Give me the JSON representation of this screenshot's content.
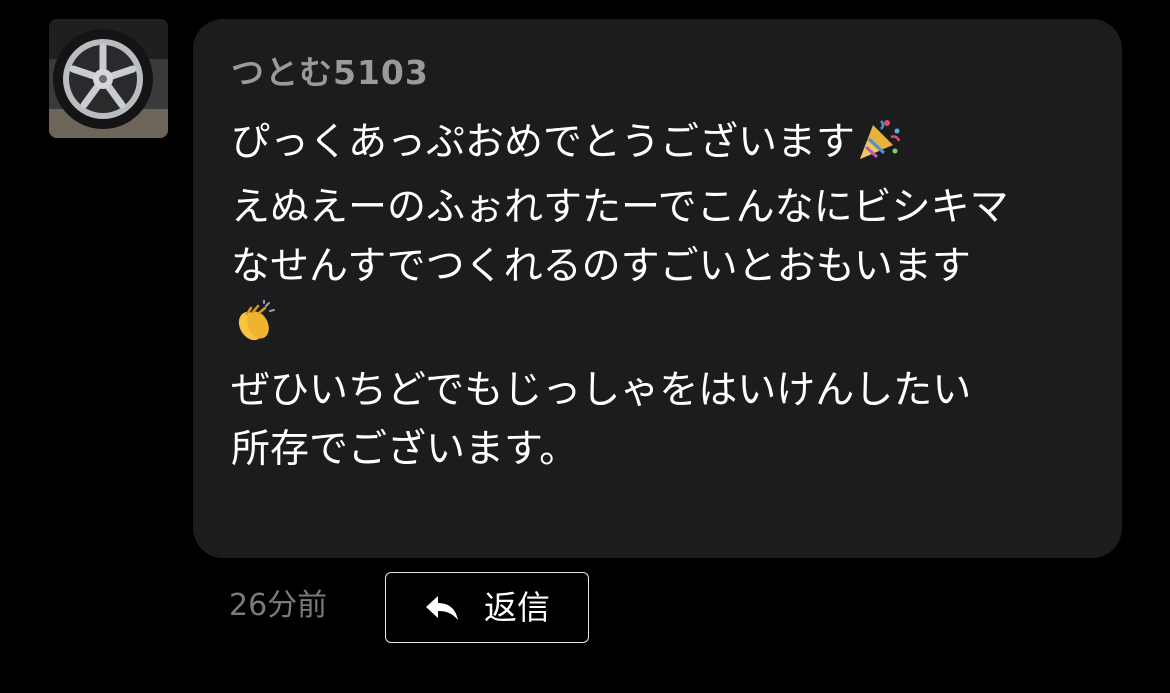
{
  "comment": {
    "username": "つとむ5103",
    "message_lines": [
      "ぴっくあっぷおめでとうございます",
      "えぬえーのふぉれすたーでこんなにビシキマ",
      "なせんすでつくれるのすごいとおもいます",
      "",
      "ぜひいちどでもじっしゃをはいけんしたい",
      "所存でございます。"
    ],
    "timestamp": "26分前",
    "reply_label": "返信",
    "icons": {
      "avatar": "car-wheel-avatar",
      "party": "party-popper-icon",
      "clap": "clapping-hands-icon",
      "reply": "reply-arrow-icon"
    },
    "colors": {
      "background": "#000000",
      "bubble": "#1c1c1e",
      "username": "#9a9a9a",
      "message": "#ffffff",
      "timestamp": "#7a7a7a"
    }
  }
}
